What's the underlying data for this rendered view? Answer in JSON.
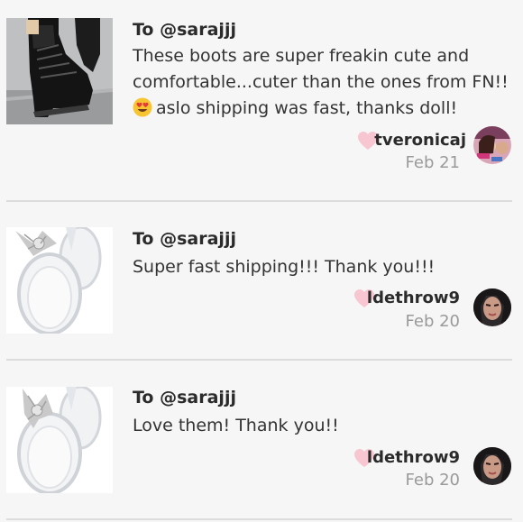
{
  "reviews": [
    {
      "recipient": "To @sarajjj",
      "message": "These boots are super freakin cute and comfortable...cuter than the ones from FN!!",
      "message_line3": "aslo shipping was fast, thanks doll!",
      "emoji": "heart-eyes-emoji",
      "author": "tveronicaj",
      "date": "Feb 21",
      "thumbnail": "black-boots-photo"
    },
    {
      "recipient": "To @sarajjj",
      "message": "Super fast shipping!!! Thank you!!!",
      "author": "ldethrow9",
      "date": "Feb 20",
      "thumbnail": "clear-bow-sandals-photo"
    },
    {
      "recipient": "To @sarajjj",
      "message": "Love them! Thank you!!",
      "author": "ldethrow9",
      "date": "Feb 20",
      "thumbnail": "clear-bow-sandals-photo"
    }
  ],
  "colors": {
    "background": "#f6f6f6",
    "heart": "#f7c6d0",
    "divider": "#dcdcdc",
    "date": "#9a9a9a"
  }
}
